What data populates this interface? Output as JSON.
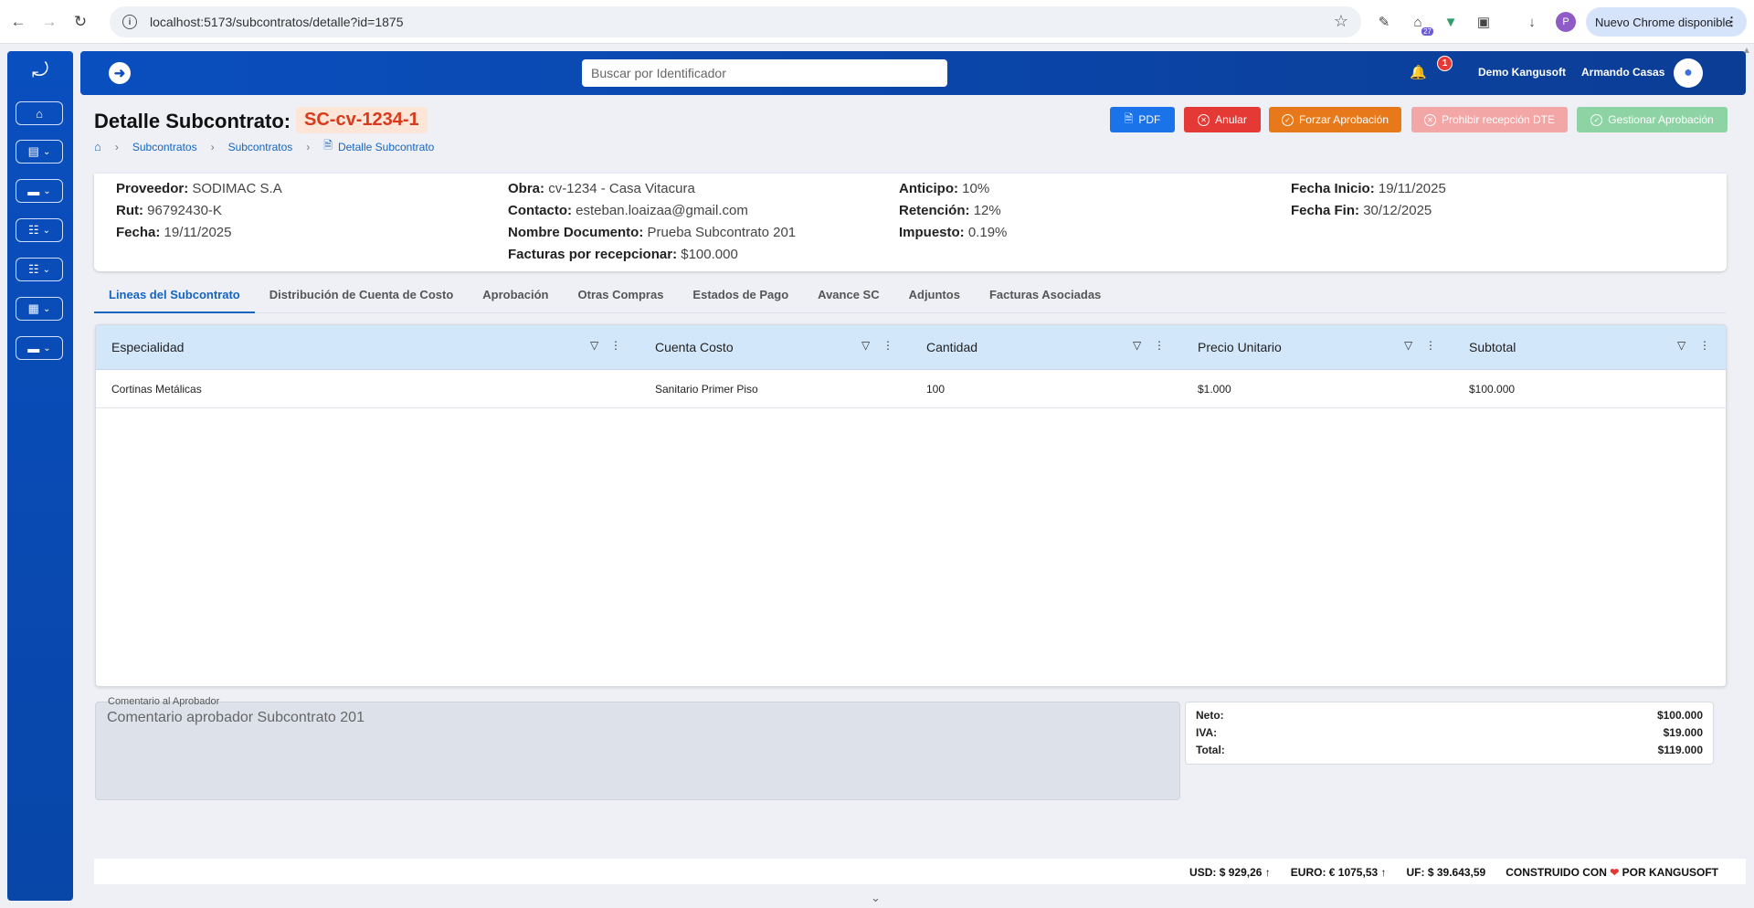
{
  "browser": {
    "url": "localhost:5173/subcontratos/detalle?id=1875",
    "profile_initial": "P",
    "ext_badge": "27",
    "update_label": "Nuevo Chrome disponible"
  },
  "header": {
    "search_placeholder": "Buscar por Identificador",
    "notifications": "1",
    "company": "Demo Kangusoft",
    "user": "Armando Casas"
  },
  "page": {
    "title": "Detalle Subcontrato:",
    "code": "SC-cv-1234-1",
    "breadcrumb": [
      "Subcontratos",
      "Subcontratos",
      "Detalle Subcontrato"
    ]
  },
  "actions": {
    "pdf": "PDF",
    "anular": "Anular",
    "forzar": "Forzar Aprobación",
    "prohibir": "Prohibir recepción DTE",
    "gestionar": "Gestionar Aprobación"
  },
  "info": {
    "proveedor_label": "Proveedor:",
    "proveedor": "SODIMAC S.A",
    "rut_label": "Rut:",
    "rut": "96792430-K",
    "fecha_label": "Fecha:",
    "fecha": "19/11/2025",
    "obra_label": "Obra:",
    "obra": "cv-1234 - Casa Vitacura",
    "contacto_label": "Contacto:",
    "contacto": "esteban.loaizaa@gmail.com",
    "nombre_doc_label": "Nombre Documento:",
    "nombre_doc": "Prueba Subcontrato 201",
    "facturas_label": "Facturas por recepcionar:",
    "facturas": "$100.000",
    "anticipo_label": "Anticipo:",
    "anticipo": "10%",
    "retencion_label": "Retención:",
    "retencion": "12%",
    "impuesto_label": "Impuesto:",
    "impuesto": "0.19%",
    "fecha_inicio_label": "Fecha Inicio:",
    "fecha_inicio": "19/11/2025",
    "fecha_fin_label": "Fecha Fin:",
    "fecha_fin": "30/12/2025"
  },
  "tabs": [
    "Lineas del Subcontrato",
    "Distribución de Cuenta de Costo",
    "Aprobación",
    "Otras Compras",
    "Estados de Pago",
    "Avance SC",
    "Adjuntos",
    "Facturas Asociadas"
  ],
  "table": {
    "columns": [
      "Especialidad",
      "Cuenta Costo",
      "Cantidad",
      "Precio Unitario",
      "Subtotal"
    ],
    "rows": [
      [
        "Cortinas Metálicas",
        "Sanitario Primer Piso",
        "100",
        "$1.000",
        "$100.000"
      ]
    ]
  },
  "comment": {
    "label": "Comentario al Aprobador",
    "value": "Comentario aprobador Subcontrato 201"
  },
  "totals": {
    "neto_label": "Neto:",
    "neto": "$100.000",
    "iva_label": "IVA:",
    "iva": "$19.000",
    "total_label": "Total:",
    "total": "$119.000"
  },
  "footer": {
    "usd": "USD: $ 929,26",
    "euro": "EURO: € 1075,53",
    "uf": "UF: $ 39.643,59",
    "built_prefix": "CONSTRUIDO CON",
    "built_suffix": "POR KANGUSOFT"
  }
}
